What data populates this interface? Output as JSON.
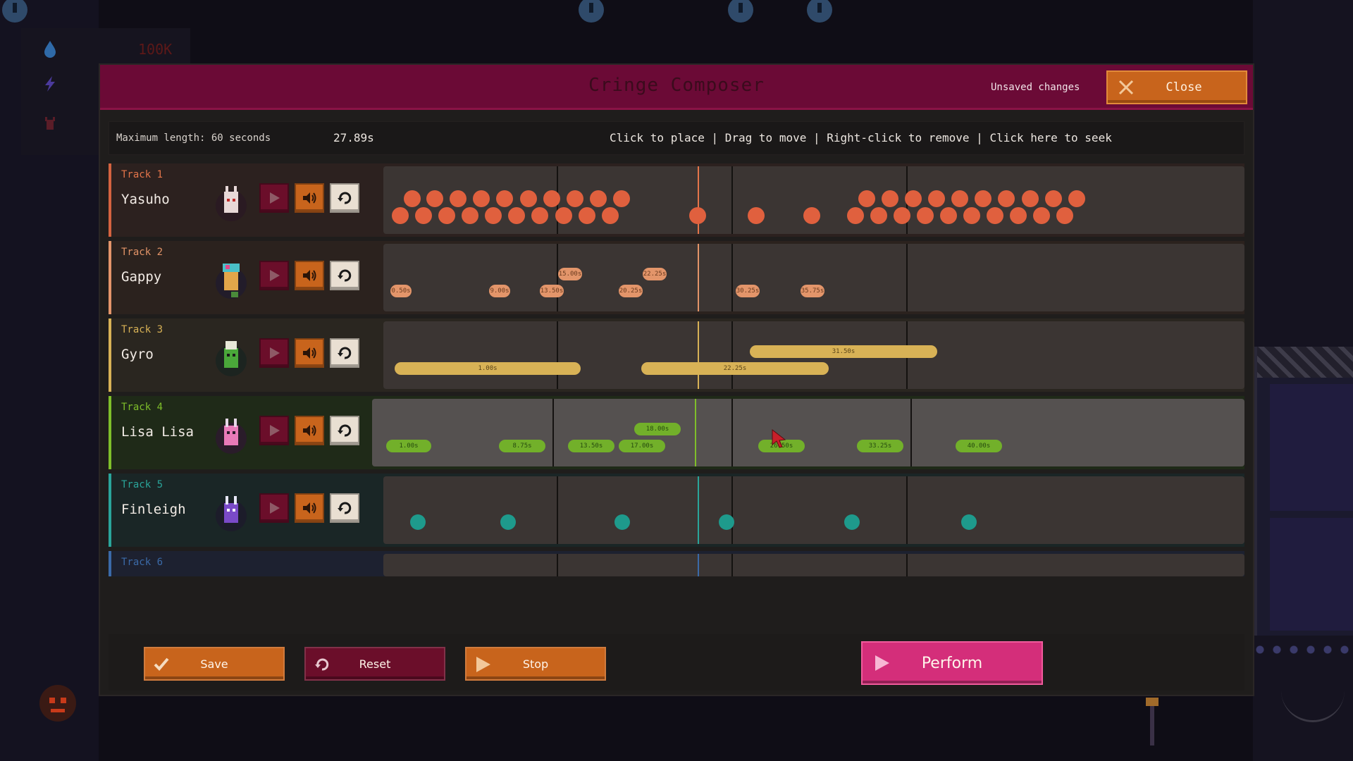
{
  "hud": {
    "money": "100K"
  },
  "composer": {
    "title": "Cringe Composer",
    "unsaved": "Unsaved changes",
    "close_label": "Close",
    "max_length": "Maximum length: 60 seconds",
    "current_time": "27.89s",
    "hint": "Click to place | Drag to move | Right-click to remove | Click here to seek"
  },
  "tracks": [
    {
      "num": "Track 1",
      "name": "Yasuho",
      "color": "#e5754a"
    },
    {
      "num": "Track 2",
      "name": "Gappy",
      "color": "#e39468"
    },
    {
      "num": "Track 3",
      "name": "Gyro",
      "color": "#d8b256"
    },
    {
      "num": "Track 4",
      "name": "Lisa Lisa",
      "color": "#7fbf2a"
    },
    {
      "num": "Track 5",
      "name": "Finleigh",
      "color": "#2aa59a"
    },
    {
      "num": "Track 6",
      "name": "",
      "color": "#3b6aa8"
    }
  ],
  "track2_notes": [
    "0.50s",
    "9.00s",
    "13.50s",
    "15.00s",
    "20.25s",
    "22.25s",
    "30.25s",
    "35.75s"
  ],
  "track3_notes": [
    "1.00s",
    "22.25s",
    "31.50s"
  ],
  "track4_notes": [
    "1.00s",
    "8.75s",
    "13.50s",
    "17.00s",
    "18.00s",
    "26.50s",
    "33.25s",
    "40.00s"
  ],
  "buttons": {
    "save": "Save",
    "reset": "Reset",
    "stop": "Stop",
    "perform": "Perform"
  }
}
